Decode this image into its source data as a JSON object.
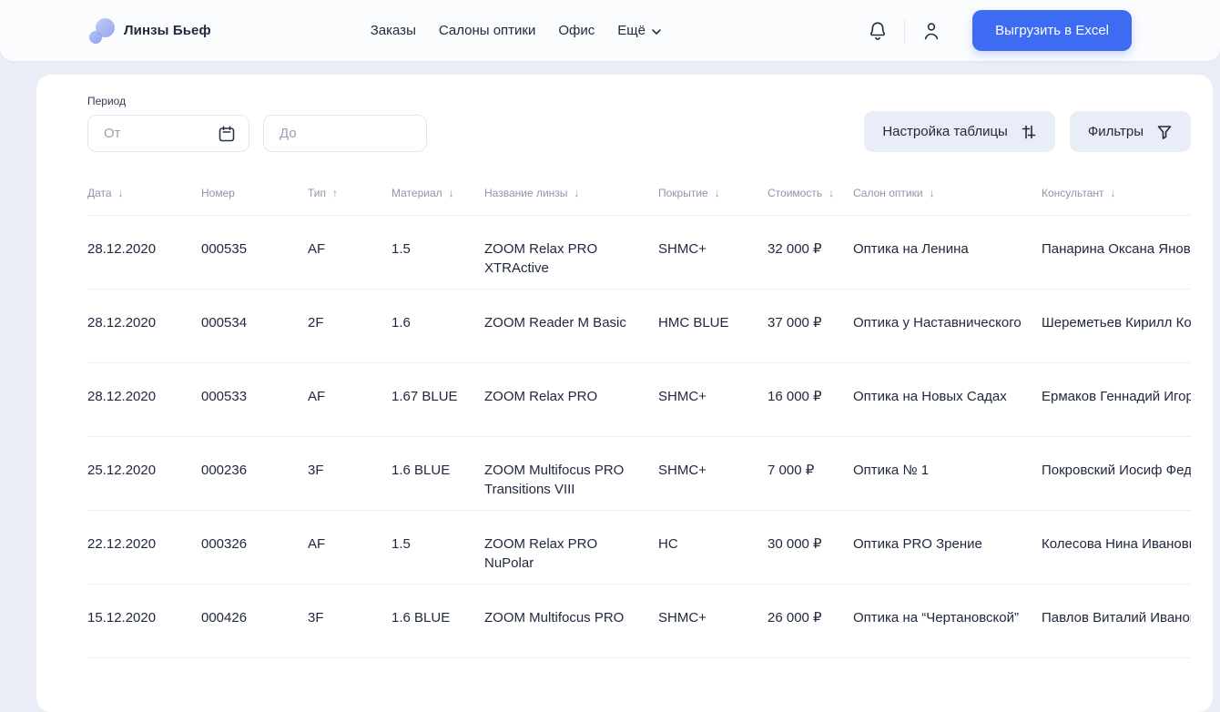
{
  "brand": {
    "name": "Линзы Бьеф"
  },
  "nav": {
    "items": [
      "Заказы",
      "Салоны оптики",
      "Офис"
    ],
    "more_label": "Ещё"
  },
  "header": {
    "export_button": "Выгрузить в Excel"
  },
  "filters": {
    "period_label": "Период",
    "from_placeholder": "От",
    "to_placeholder": "До",
    "table_settings_button": "Настройка таблицы",
    "filters_button": "Фильтры"
  },
  "table": {
    "columns": [
      {
        "label": "Дата",
        "sort": "↓"
      },
      {
        "label": "Номер",
        "sort": ""
      },
      {
        "label": "Тип",
        "sort": "↑"
      },
      {
        "label": "Материал",
        "sort": "↓"
      },
      {
        "label": "Название линзы",
        "sort": "↓"
      },
      {
        "label": "Покрытие",
        "sort": "↓"
      },
      {
        "label": "Стоимость",
        "sort": "↓"
      },
      {
        "label": "Салон оптики",
        "sort": "↓"
      },
      {
        "label": "Консультант",
        "sort": "↓"
      }
    ],
    "rows": [
      {
        "date": "28.12.2020",
        "number": "000535",
        "type": "AF",
        "material": "1.5",
        "lens": "ZOOM Relax PRO XTRActive",
        "coating": "SHMC+",
        "price": "32 000 ₽",
        "salon": "Оптика на Ленина",
        "consultant": "Панарина Оксана Яновн"
      },
      {
        "date": "28.12.2020",
        "number": "000534",
        "type": "2F",
        "material": "1.6",
        "lens": "ZOOM Reader M Basic",
        "coating": "HMC BLUE",
        "price": "37 000 ₽",
        "salon": "Оптика у Наставнического",
        "consultant": "Шереметьев Кирилл Ко"
      },
      {
        "date": "28.12.2020",
        "number": "000533",
        "type": "AF",
        "material": "1.67 BLUE",
        "lens": "ZOOM Relax PRO",
        "coating": "SHMC+",
        "price": "16 000 ₽",
        "salon": "Оптика на Новых Садах",
        "consultant": "Ермаков Геннадий Игор"
      },
      {
        "date": "25.12.2020",
        "number": "000236",
        "type": "3F",
        "material": "1.6 BLUE",
        "lens": "ZOOM Multifocus PRO Transitions VIII",
        "coating": "SHMC+",
        "price": "7 000 ₽",
        "salon": "Оптика № 1",
        "consultant": "Покровский Иосиф Фед"
      },
      {
        "date": "22.12.2020",
        "number": "000326",
        "type": "AF",
        "material": "1.5",
        "lens": "ZOOM Relax PRO NuPolar",
        "coating": "HC",
        "price": "30 000 ₽",
        "salon": "Оптика PRO Зрение",
        "consultant": "Колесова Нина Ивановн"
      },
      {
        "date": "15.12.2020",
        "number": "000426",
        "type": "3F",
        "material": "1.6 BLUE",
        "lens": "ZOOM Multifocus PRO",
        "coating": "SHMC+",
        "price": "26 000 ₽",
        "salon": "Оптика на “Чертановской”",
        "consultant": "Павлов Виталий Иванов"
      }
    ]
  },
  "colors": {
    "accent": "#3D6BF2",
    "chip_bg": "#E8EDF8",
    "page_bg": "#EAEDF5",
    "text": "#20293F",
    "muted": "#8D95AA"
  }
}
